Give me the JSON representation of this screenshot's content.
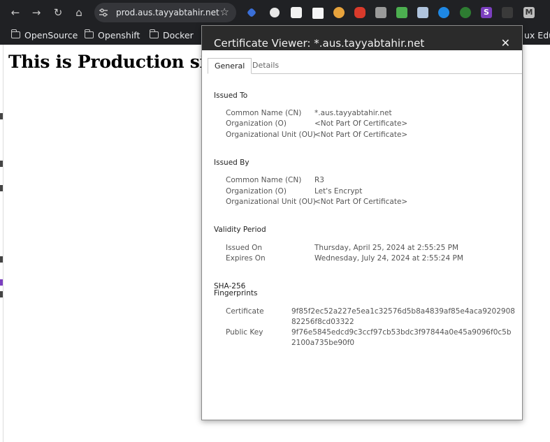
{
  "browser": {
    "url": "prod.aus.tayyabtahir.net",
    "bookmarks": [
      "OpenSource",
      "Openshift",
      "Docker"
    ],
    "bookmark_overflow": "ux Edu",
    "extension_s_label": "S",
    "extension_m_label": "M"
  },
  "page": {
    "heading": "This is Production site."
  },
  "dialog": {
    "title": "Certificate Viewer: *.aus.tayyabtahir.net",
    "tabs": [
      "General",
      "Details"
    ],
    "issued_to": {
      "heading": "Issued To",
      "rows": [
        {
          "label": "Common Name (CN)",
          "value": "*.aus.tayyabtahir.net"
        },
        {
          "label": "Organization (O)",
          "value": "<Not Part Of Certificate>"
        },
        {
          "label": "Organizational Unit (OU)",
          "value": "<Not Part Of Certificate>"
        }
      ]
    },
    "issued_by": {
      "heading": "Issued By",
      "rows": [
        {
          "label": "Common Name (CN)",
          "value": "R3"
        },
        {
          "label": "Organization (O)",
          "value": "Let's Encrypt"
        },
        {
          "label": "Organizational Unit (OU)",
          "value": "<Not Part Of Certificate>"
        }
      ]
    },
    "validity": {
      "heading": "Validity Period",
      "rows": [
        {
          "label": "Issued On",
          "value": "Thursday, April 25, 2024 at 2:55:25 PM"
        },
        {
          "label": "Expires On",
          "value": "Wednesday, July 24, 2024 at 2:55:24 PM"
        }
      ]
    },
    "fingerprints": {
      "heading_line1": "SHA-256",
      "heading_line2": "Fingerprints",
      "rows": [
        {
          "label": "Certificate",
          "value": "9f85f2ec52a227e5ea1c32576d5b8a4839af85e4aca920290882256f8cd03322"
        },
        {
          "label": "Public Key",
          "value": "9f76e5845edcd9c3ccf97cb53bdc3f97844a0e45a9096f0c5b2100a735be90f0"
        }
      ]
    }
  }
}
